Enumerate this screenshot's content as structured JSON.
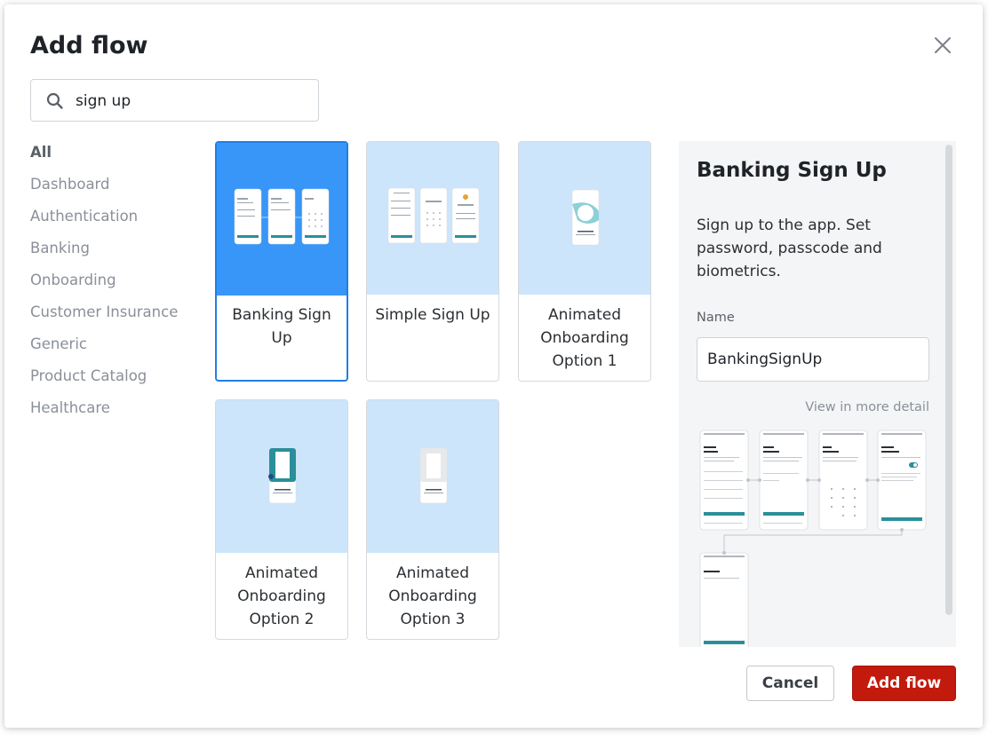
{
  "dialog": {
    "title": "Add flow",
    "close_icon": "close-icon"
  },
  "search": {
    "value": "sign up",
    "icon": "search-icon"
  },
  "categories": [
    {
      "label": "All",
      "active": true
    },
    {
      "label": "Dashboard"
    },
    {
      "label": "Authentication"
    },
    {
      "label": "Banking"
    },
    {
      "label": "Onboarding"
    },
    {
      "label": "Customer Insurance"
    },
    {
      "label": "Generic"
    },
    {
      "label": "Product Catalog"
    },
    {
      "label": "Healthcare"
    }
  ],
  "cards": [
    {
      "label": "Banking Sign Up",
      "selected": true
    },
    {
      "label": "Simple Sign Up"
    },
    {
      "label": "Animated Onboarding Option 1"
    },
    {
      "label": "Animated Onboarding Option 2"
    },
    {
      "label": "Animated Onboarding Option 3"
    }
  ],
  "detail": {
    "title": "Banking Sign Up",
    "description": "Sign up to the app. Set password, passcode and biometrics.",
    "name_label": "Name",
    "name_value": "BankingSignUp",
    "view_more": "View in more detail"
  },
  "footer": {
    "cancel": "Cancel",
    "add": "Add flow"
  },
  "colors": {
    "accent": "#1e7fe6",
    "selected_thumb": "#3796f7",
    "thumb": "#cce5fb",
    "primary_button": "#c21a0d",
    "teal": "#2a8f9a"
  }
}
